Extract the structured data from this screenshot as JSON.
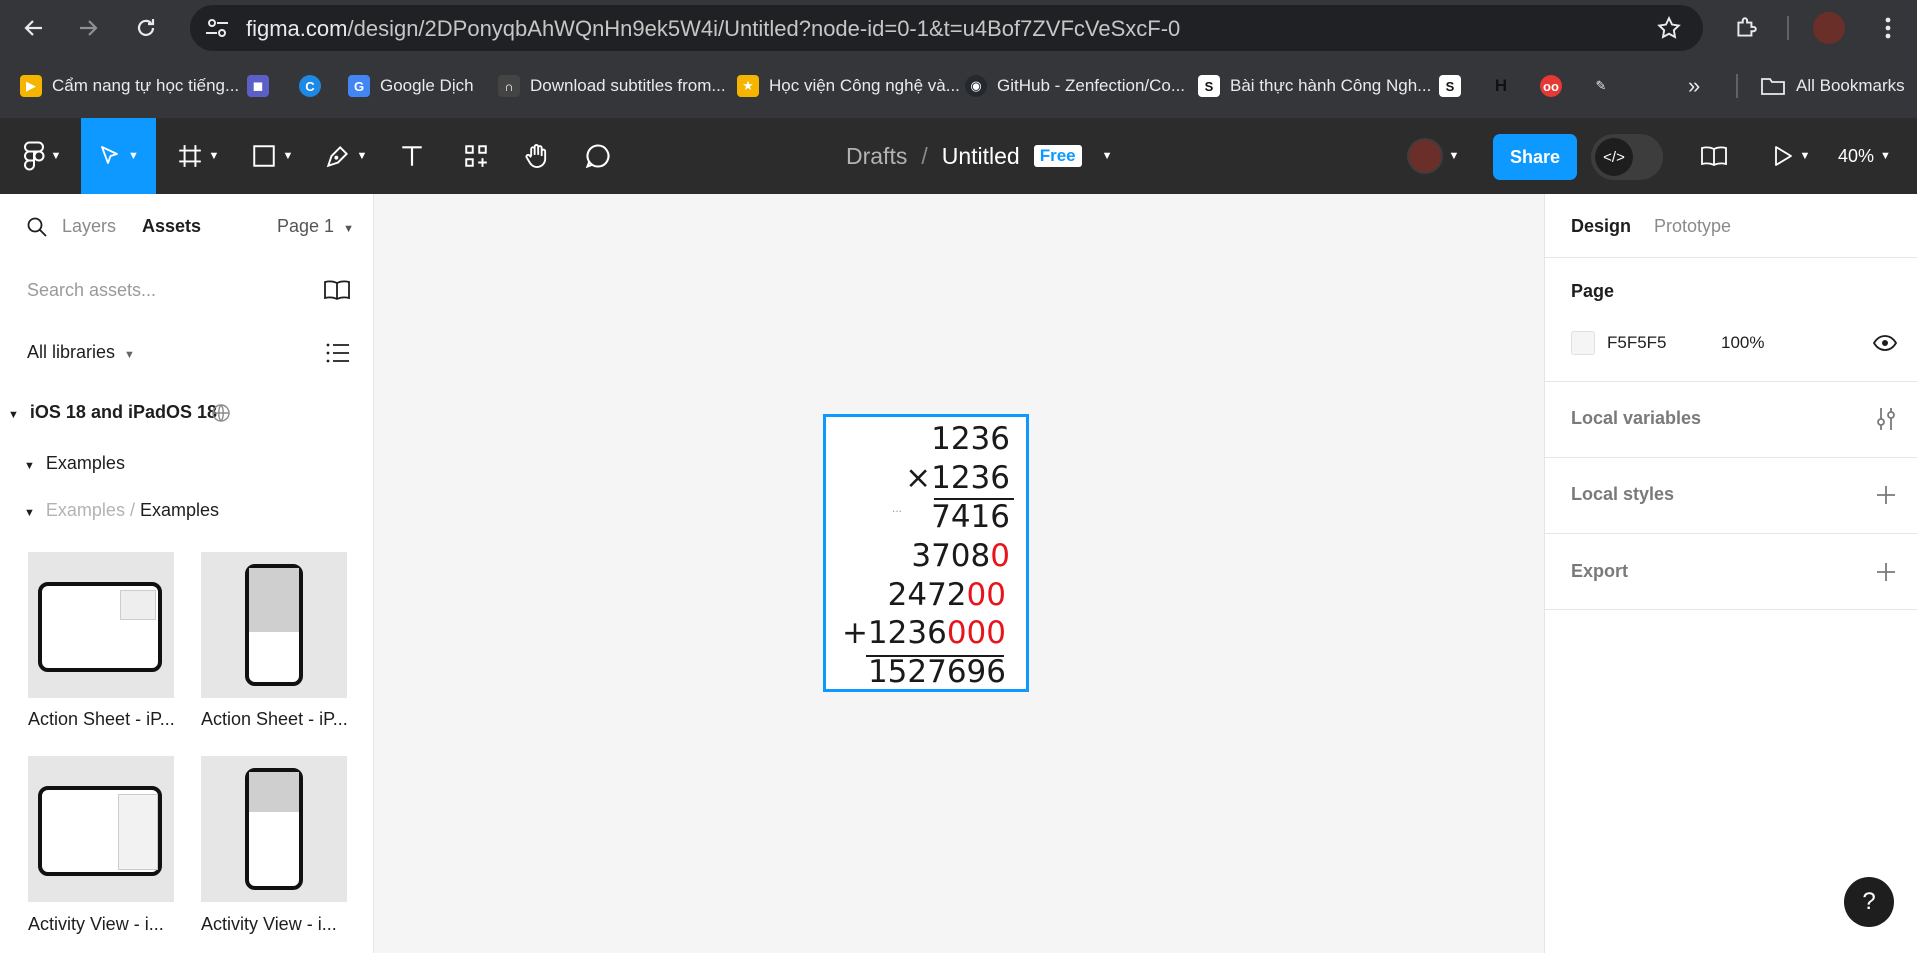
{
  "browser": {
    "url_host": "figma.com",
    "url_path": "/design/2DPonyqbAhWQnHn9ek5W4i/Untitled?node-id=0-1&t=u4Bof7ZVFcVeSxcF-0",
    "bookmarks": [
      {
        "label": "Cẩm nang tự học tiếng...",
        "color": "#f4b400"
      },
      {
        "label": "",
        "color": "#5b5fc7"
      },
      {
        "label": "",
        "color": "#1e88e5"
      },
      {
        "label": "Google Dịch",
        "color": "#4285f4"
      },
      {
        "label": "Download subtitles from...",
        "color": "#444444"
      },
      {
        "label": "Học viện Công nghệ và...",
        "color": "#f4b400"
      },
      {
        "label": "GitHub - Zenfection/Co...",
        "color": "#24292f"
      },
      {
        "label": "Bài thực hành Công Ngh...",
        "color": "#111111"
      },
      {
        "label": "",
        "color": "#111111"
      },
      {
        "label": "H",
        "color": "#35363a"
      },
      {
        "label": "",
        "color": "#e53935"
      },
      {
        "label": "",
        "color": "#35363a"
      }
    ],
    "all_bookmarks_label": "All Bookmarks"
  },
  "toolbar": {
    "crumb_drafts": "Drafts",
    "crumb_sep": "/",
    "file_name": "Untitled",
    "plan_badge": "Free",
    "share_label": "Share",
    "zoom": "40%"
  },
  "left_panel": {
    "tab_layers": "Layers",
    "tab_assets": "Assets",
    "page_selector": "Page 1",
    "search_placeholder": "Search assets...",
    "libraries_label": "All libraries",
    "library_name": "iOS 18 and iPadOS 18",
    "group_examples": "Examples",
    "sub_path_parent": "Examples /",
    "sub_path_child": "Examples",
    "assets": [
      {
        "label": "Action Sheet - iP..."
      },
      {
        "label": "Action Sheet - iP..."
      },
      {
        "label": "Activity View - i..."
      },
      {
        "label": "Activity View - i..."
      }
    ]
  },
  "right_panel": {
    "tab_design": "Design",
    "tab_prototype": "Prototype",
    "page_heading": "Page",
    "page_color": "F5F5F5",
    "page_opacity": "100%",
    "local_variables": "Local variables",
    "local_styles": "Local styles",
    "export": "Export",
    "page_swatch_color": "#F5F5F5"
  },
  "canvas": {
    "multiplicand": "1236",
    "multiplier": "×1236",
    "ellipsis": "...",
    "partial_1": "7416",
    "partial_2_black": "3708",
    "partial_2_red": "0",
    "partial_3_black": "2472",
    "partial_3_red": "00",
    "partial_4_black": "+1236",
    "partial_4_red": "000",
    "result": "1527696"
  },
  "help_label": "?"
}
